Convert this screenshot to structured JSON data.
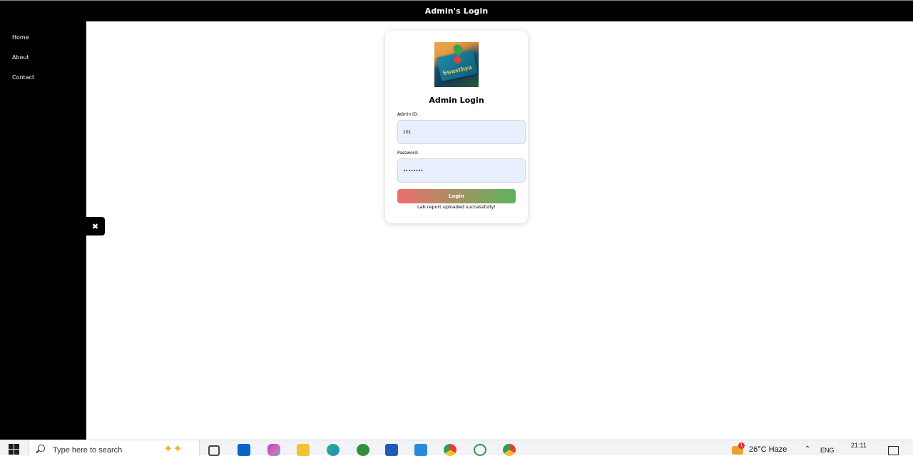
{
  "header": {
    "title": "Admin's Login"
  },
  "sidebar": {
    "items": [
      {
        "label": "Home"
      },
      {
        "label": "About"
      },
      {
        "label": "Contact"
      }
    ],
    "close_symbol": "✖"
  },
  "card": {
    "logo_text": "Swasthya",
    "heading": "Admin Login",
    "admin_id_label": "Admin ID:",
    "admin_id_value": "101",
    "password_label": "Password:",
    "password_value": "••••••••",
    "login_label": "Login",
    "message": "Lab report uploaded successfully!"
  },
  "taskbar": {
    "search_placeholder": "Type here to search",
    "weather": "26°C  Haze",
    "language": "ENG",
    "time": "21:11",
    "notification_count": "1"
  },
  "colors": {
    "login_gradient_start": "#ee6e6e",
    "login_gradient_end": "#5db35a",
    "input_bg": "#e8f0fe"
  }
}
